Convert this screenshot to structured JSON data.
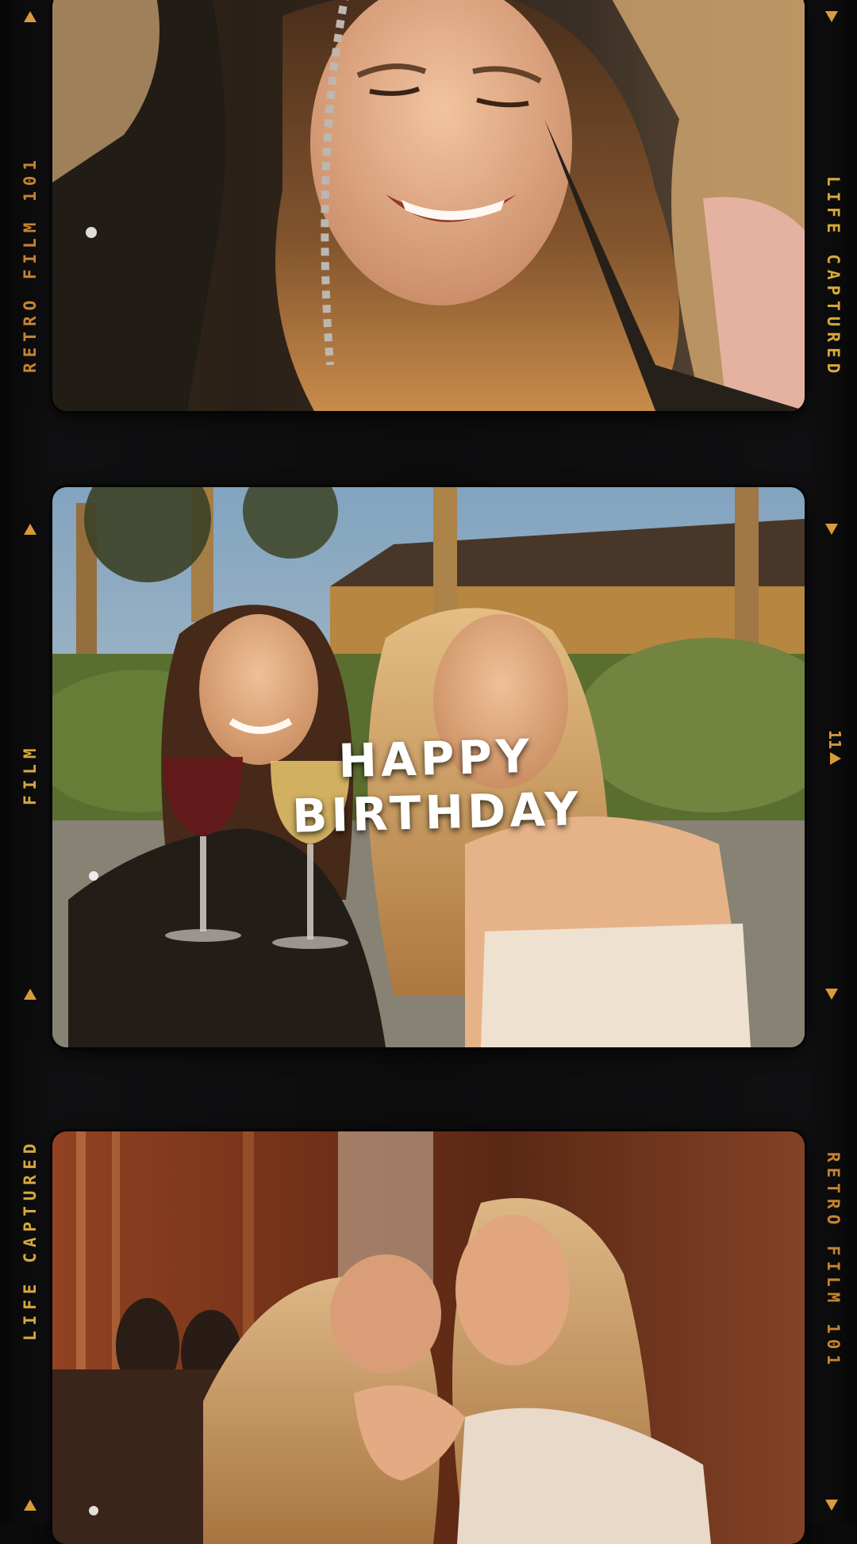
{
  "overlay": {
    "headline": "HAPPY BIRTHDAY"
  },
  "film_edge": {
    "left_top": "RETRO FILM 101",
    "left_mid": "FILM",
    "left_bottom": "LIFE CAPTURED",
    "right_top": "LIFE CAPTURED",
    "right_mid": "11",
    "right_bottom": "RETRO FILM 101"
  },
  "colors": {
    "edge_text": "#c8832f",
    "marker": "#d99a3a",
    "strip": "#0b0b0c",
    "headline": "#ffffff"
  }
}
